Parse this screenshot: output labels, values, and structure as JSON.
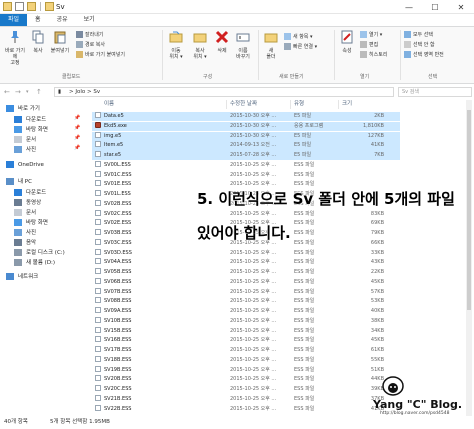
{
  "window": {
    "title": "Sv",
    "controls": [
      "—",
      "☐",
      "✕"
    ]
  },
  "ribbon_tabs": [
    "파일",
    "홈",
    "공유",
    "보기"
  ],
  "ribbon": {
    "clipboard": {
      "pin_label": "바로 가기에\n고정",
      "copy_label": "복사",
      "paste_label": "붙여넣기",
      "cut_label": "잘라내기",
      "copy_path_label": "경로 복사",
      "paste_shortcut_label": "바로 가기 붙여넣기",
      "group_label": "클립보드"
    },
    "organize": {
      "move_label": "이동\n위치 ▾",
      "copy_to_label": "복사\n위치 ▾",
      "delete_label": "삭제",
      "rename_label": "이름\n바꾸기",
      "group_label": "구성"
    },
    "new": {
      "new_folder_label": "새\n폴더",
      "new_item_label": "새 항목 ▾",
      "easy_access_label": "빠른 연결 ▾",
      "group_label": "새로 만들기"
    },
    "open": {
      "properties_label": "속성",
      "open_label": "열기 ▾",
      "edit_label": "편집",
      "history_label": "히스토리",
      "group_label": "열기"
    },
    "select": {
      "select_all_label": "모두 선택",
      "select_none_label": "선택 안 함",
      "invert_label": "선택 영역 반전",
      "group_label": "선택"
    }
  },
  "address": {
    "path": "> Jolo > Sv",
    "search_placeholder": "Sv 검색"
  },
  "nav_pane": [
    {
      "label": "바로 가기",
      "icon": "star-icon",
      "pinned": false
    },
    {
      "label": "다운로드",
      "icon": "download-icon",
      "pinned": true
    },
    {
      "label": "바탕 화면",
      "icon": "desktop-icon",
      "pinned": true
    },
    {
      "label": "문서",
      "icon": "document-icon",
      "pinned": true
    },
    {
      "label": "사진",
      "icon": "picture-icon",
      "pinned": true
    },
    {
      "label": "OneDrive",
      "icon": "cloud-icon",
      "pinned": false
    },
    {
      "label": "내 PC",
      "icon": "computer-icon",
      "pinned": false
    },
    {
      "label": "다운로드",
      "icon": "download-icon",
      "pinned": false
    },
    {
      "label": "동영상",
      "icon": "video-icon",
      "pinned": false
    },
    {
      "label": "문서",
      "icon": "document-icon",
      "pinned": false
    },
    {
      "label": "바탕 화면",
      "icon": "desktop-icon",
      "pinned": false
    },
    {
      "label": "사진",
      "icon": "picture-icon",
      "pinned": false
    },
    {
      "label": "음악",
      "icon": "music-icon",
      "pinned": false
    },
    {
      "label": "로컬 디스크 (C:)",
      "icon": "drive-icon",
      "pinned": false
    },
    {
      "label": "새 볼륨 (D:)",
      "icon": "drive-icon",
      "pinned": false
    },
    {
      "label": "네트워크",
      "icon": "network-icon",
      "pinned": false
    }
  ],
  "columns": [
    "이름",
    "수정한 날짜",
    "유형",
    "크기"
  ],
  "files": [
    {
      "name": "Data.e5",
      "date": "2015-10-30 오후 ...",
      "type": "E5 파일",
      "size": "2KB",
      "selected": true,
      "icon": "file"
    },
    {
      "name": "Ekd5.exe",
      "date": "2015-10-30 오후 ...",
      "type": "응용 프로그램",
      "size": "1,810KB",
      "selected": true,
      "icon": "exe"
    },
    {
      "name": "img.e5",
      "date": "2015-10-30 오후 ...",
      "type": "E5 파일",
      "size": "127KB",
      "selected": true,
      "icon": "file"
    },
    {
      "name": "Item.e5",
      "date": "2014-09-13 오전 ...",
      "type": "E5 파일",
      "size": "41KB",
      "selected": true,
      "icon": "file"
    },
    {
      "name": "star.e5",
      "date": "2015-07-28 오후 ...",
      "type": "E5 파일",
      "size": "7KB",
      "selected": true,
      "icon": "file"
    },
    {
      "name": "SV00L.ESS",
      "date": "2015-10-25 오후 ...",
      "type": "ESS 파일",
      "size": "",
      "selected": false,
      "icon": "file"
    },
    {
      "name": "SV01C.ESS",
      "date": "2015-10-25 오후 ...",
      "type": "ESS 파일",
      "size": "",
      "selected": false,
      "icon": "file"
    },
    {
      "name": "SV01E.ESS",
      "date": "2015-10-25 오후 ...",
      "type": "ESS 파일",
      "size": "",
      "selected": false,
      "icon": "file"
    },
    {
      "name": "SV01L.ESS",
      "date": "2015-10-25 오후 ...",
      "type": "ESS 파일",
      "size": "",
      "selected": false,
      "icon": "file"
    },
    {
      "name": "SV02B.ESS",
      "date": "2015-10-25 오후 ...",
      "type": "ESS 파일",
      "size": "",
      "selected": false,
      "icon": "file"
    },
    {
      "name": "SV02C.ESS",
      "date": "2015-10-25 오후 ...",
      "type": "ESS 파일",
      "size": "83KB",
      "selected": false,
      "icon": "file"
    },
    {
      "name": "SV02E.ESS",
      "date": "2015-10-25 오후 ...",
      "type": "ESS 파일",
      "size": "69KB",
      "selected": false,
      "icon": "file"
    },
    {
      "name": "SV03B.ESS",
      "date": "2015-10-25 오후 ...",
      "type": "ESS 파일",
      "size": "79KB",
      "selected": false,
      "icon": "file"
    },
    {
      "name": "SV03C.ESS",
      "date": "2015-10-25 오후 ...",
      "type": "ESS 파일",
      "size": "66KB",
      "selected": false,
      "icon": "file"
    },
    {
      "name": "SV03D.ESS",
      "date": "2015-10-25 오후 ...",
      "type": "ESS 파일",
      "size": "33KB",
      "selected": false,
      "icon": "file"
    },
    {
      "name": "SV04A.ESS",
      "date": "2015-10-25 오후 ...",
      "type": "ESS 파일",
      "size": "43KB",
      "selected": false,
      "icon": "file"
    },
    {
      "name": "SV05B.ESS",
      "date": "2015-10-25 오후 ...",
      "type": "ESS 파일",
      "size": "22KB",
      "selected": false,
      "icon": "file"
    },
    {
      "name": "SV06B.ESS",
      "date": "2015-10-25 오후 ...",
      "type": "ESS 파일",
      "size": "45KB",
      "selected": false,
      "icon": "file"
    },
    {
      "name": "SV07B.ESS",
      "date": "2015-10-25 오후 ...",
      "type": "ESS 파일",
      "size": "57KB",
      "selected": false,
      "icon": "file"
    },
    {
      "name": "SV08B.ESS",
      "date": "2015-10-25 오후 ...",
      "type": "ESS 파일",
      "size": "53KB",
      "selected": false,
      "icon": "file"
    },
    {
      "name": "SV09A.ESS",
      "date": "2015-10-25 오후 ...",
      "type": "ESS 파일",
      "size": "40KB",
      "selected": false,
      "icon": "file"
    },
    {
      "name": "SV10B.ESS",
      "date": "2015-10-25 오후 ...",
      "type": "ESS 파일",
      "size": "38KB",
      "selected": false,
      "icon": "file"
    },
    {
      "name": "SV15B.ESS",
      "date": "2015-10-25 오후 ...",
      "type": "ESS 파일",
      "size": "34KB",
      "selected": false,
      "icon": "file"
    },
    {
      "name": "SV16B.ESS",
      "date": "2015-10-25 오후 ...",
      "type": "ESS 파일",
      "size": "45KB",
      "selected": false,
      "icon": "file"
    },
    {
      "name": "SV17B.ESS",
      "date": "2015-10-25 오후 ...",
      "type": "ESS 파일",
      "size": "61KB",
      "selected": false,
      "icon": "file"
    },
    {
      "name": "SV18B.ESS",
      "date": "2015-10-25 오후 ...",
      "type": "ESS 파일",
      "size": "55KB",
      "selected": false,
      "icon": "file"
    },
    {
      "name": "SV19B.ESS",
      "date": "2015-10-25 오후 ...",
      "type": "ESS 파일",
      "size": "51KB",
      "selected": false,
      "icon": "file"
    },
    {
      "name": "SV20B.ESS",
      "date": "2015-10-25 오후 ...",
      "type": "ESS 파일",
      "size": "44KB",
      "selected": false,
      "icon": "file"
    },
    {
      "name": "SV20C.ESS",
      "date": "2015-10-25 오후 ...",
      "type": "ESS 파일",
      "size": "39KB",
      "selected": false,
      "icon": "file"
    },
    {
      "name": "SV21B.ESS",
      "date": "2015-10-25 오후 ...",
      "type": "ESS 파일",
      "size": "37KB",
      "selected": false,
      "icon": "file"
    },
    {
      "name": "SV22B.ESS",
      "date": "2015-10-25 오후 ...",
      "type": "ESS 파일",
      "size": "41KB",
      "selected": false,
      "icon": "file"
    }
  ],
  "overlay": {
    "line1": "5. 이런식으로 Sv 폴더 안에 5개의 파일",
    "line2": "있어야 합니다."
  },
  "status": {
    "count": "40개 항목",
    "selection": "5개 항목 선택함 1.95MB"
  },
  "watermark": {
    "text": "Yang \"C\" Blog.",
    "url": "http://blog.naver.com/psd4548"
  },
  "colors": {
    "accent": "#1979ca",
    "selection": "#cce8ff"
  }
}
